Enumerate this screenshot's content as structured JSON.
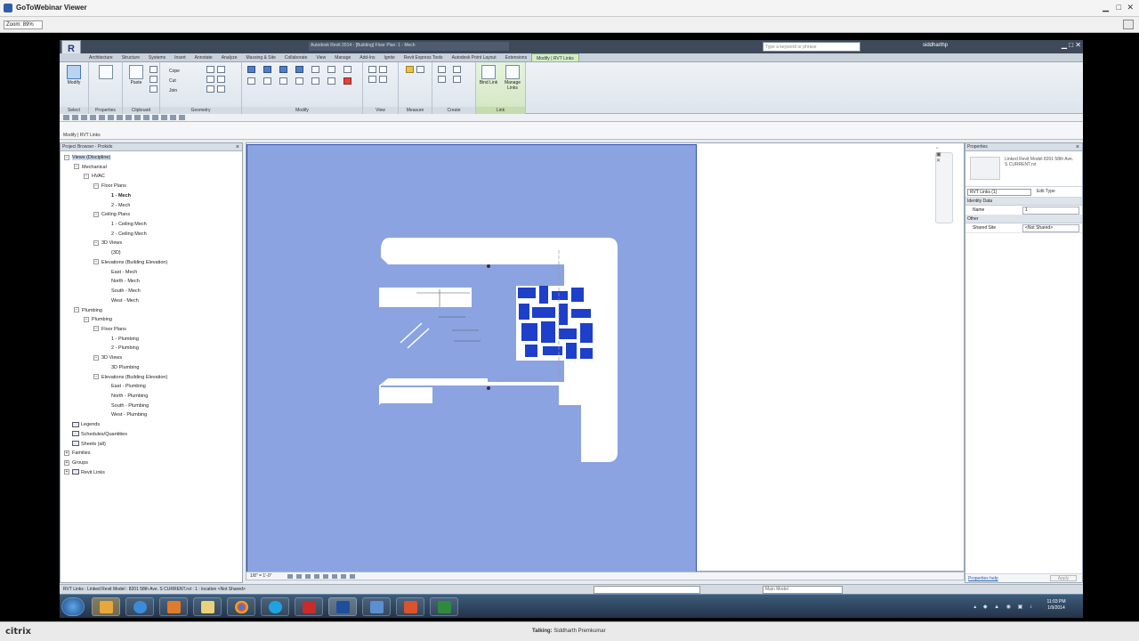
{
  "outer_window": {
    "title": "GoToWebinar Viewer",
    "zoom_label": "Zoom: 89%"
  },
  "revit": {
    "document_title": "Autodesk Revit 2014 - [Building] Floor Plan: 1 - Mech",
    "search_placeholder": "Type a keyword or phrase",
    "user": "siddharthp",
    "tabs": [
      "Architecture",
      "Structure",
      "Systems",
      "Insert",
      "Annotate",
      "Analyze",
      "Massing & Site",
      "Collaborate",
      "View",
      "Manage",
      "Add-Ins",
      "Ignite",
      "Revit Express Tools",
      "Autodesk Point Layout",
      "Extensions",
      "Modify | RVT Links"
    ],
    "active_tab_index": 15,
    "ribbon": {
      "modify_label": "Modify",
      "select_label": "Select",
      "properties_label": "Properties",
      "clipboard_label": "Clipboard",
      "paste_label": "Paste",
      "cope_label": "Cope",
      "cut_label": "Cut",
      "join_label": "Join",
      "geometry_label": "Geometry",
      "modify_panel_label": "Modify",
      "view_label": "View",
      "measure_label": "Measure",
      "create_label": "Create",
      "link_panel_label": "Link",
      "bind_link_label": "Bind Link",
      "manage_links_label": "Manage Links"
    },
    "context_label": "Modify | RVT Links",
    "browser": {
      "title": "Project Browser - Prokids",
      "items": [
        {
          "label": "Views (Discipline)",
          "indent": 0,
          "tog": "−",
          "hl": true
        },
        {
          "label": "Mechanical",
          "indent": 1,
          "tog": "−"
        },
        {
          "label": "HVAC",
          "indent": 2,
          "tog": "−"
        },
        {
          "label": "Floor Plans",
          "indent": 3,
          "tog": "−"
        },
        {
          "label": "1 - Mech",
          "indent": 4,
          "bold": true
        },
        {
          "label": "2 - Mech",
          "indent": 4
        },
        {
          "label": "Ceiling Plans",
          "indent": 3,
          "tog": "−"
        },
        {
          "label": "1 - Ceiling Mech",
          "indent": 4
        },
        {
          "label": "2 - Ceiling Mech",
          "indent": 4
        },
        {
          "label": "3D Views",
          "indent": 3,
          "tog": "−"
        },
        {
          "label": "{3D}",
          "indent": 4
        },
        {
          "label": "Elevations (Building Elevation)",
          "indent": 3,
          "tog": "−"
        },
        {
          "label": "East - Mech",
          "indent": 4
        },
        {
          "label": "North - Mech",
          "indent": 4
        },
        {
          "label": "South - Mech",
          "indent": 4
        },
        {
          "label": "West - Mech",
          "indent": 4
        },
        {
          "label": "Plumbing",
          "indent": 1,
          "tog": "−"
        },
        {
          "label": "Plumbing",
          "indent": 2,
          "tog": "−"
        },
        {
          "label": "Floor Plans",
          "indent": 3,
          "tog": "−"
        },
        {
          "label": "1 - Plumbing",
          "indent": 4
        },
        {
          "label": "2 - Plumbing",
          "indent": 4
        },
        {
          "label": "3D Views",
          "indent": 3,
          "tog": "−"
        },
        {
          "label": "3D Plumbing",
          "indent": 4
        },
        {
          "label": "Elevations (Building Elevation)",
          "indent": 3,
          "tog": "−"
        },
        {
          "label": "East - Plumbing",
          "indent": 4
        },
        {
          "label": "North - Plumbing",
          "indent": 4
        },
        {
          "label": "South - Plumbing",
          "indent": 4
        },
        {
          "label": "West - Plumbing",
          "indent": 4
        },
        {
          "label": "Legends",
          "indent": 0,
          "icon": true
        },
        {
          "label": "Schedules/Quantities",
          "indent": 0,
          "icon": true
        },
        {
          "label": "Sheets (all)",
          "indent": 0,
          "icon": true
        },
        {
          "label": "Families",
          "indent": 0,
          "tog": "+"
        },
        {
          "label": "Groups",
          "indent": 0,
          "tog": "+"
        },
        {
          "label": "Revit Links",
          "indent": 0,
          "tog": "+",
          "icon": true
        }
      ]
    },
    "viewcontrol_scale": "1/8\" = 1'-0\"",
    "properties": {
      "title": "Properties",
      "type_name": "Linked Revit Model 8201 58th Ave. S CURRENT.rvt",
      "type_selector": "RVT Links (1)",
      "edit_type": "Edit Type",
      "groups": [
        {
          "name": "Identity Data",
          "rows": [
            {
              "label": "Name",
              "value": "1"
            }
          ]
        },
        {
          "name": "Other",
          "rows": [
            {
              "label": "Shared Site",
              "value": "<Not Shared>"
            }
          ]
        }
      ],
      "help_link": "Properties help",
      "apply": "Apply"
    },
    "status_text": "RVT Links : Linked Revit Model : 8201 58th Ave. S CURRENT.rvt : 1 : location <Not Shared>",
    "main_model": "Main Model"
  },
  "taskbar": {
    "time": "11:03 PM",
    "date": "1/9/2014"
  },
  "citrix": {
    "logo": "citrix",
    "talking_label": "Talking:",
    "talking_name": "Siddharth Premkumar"
  }
}
